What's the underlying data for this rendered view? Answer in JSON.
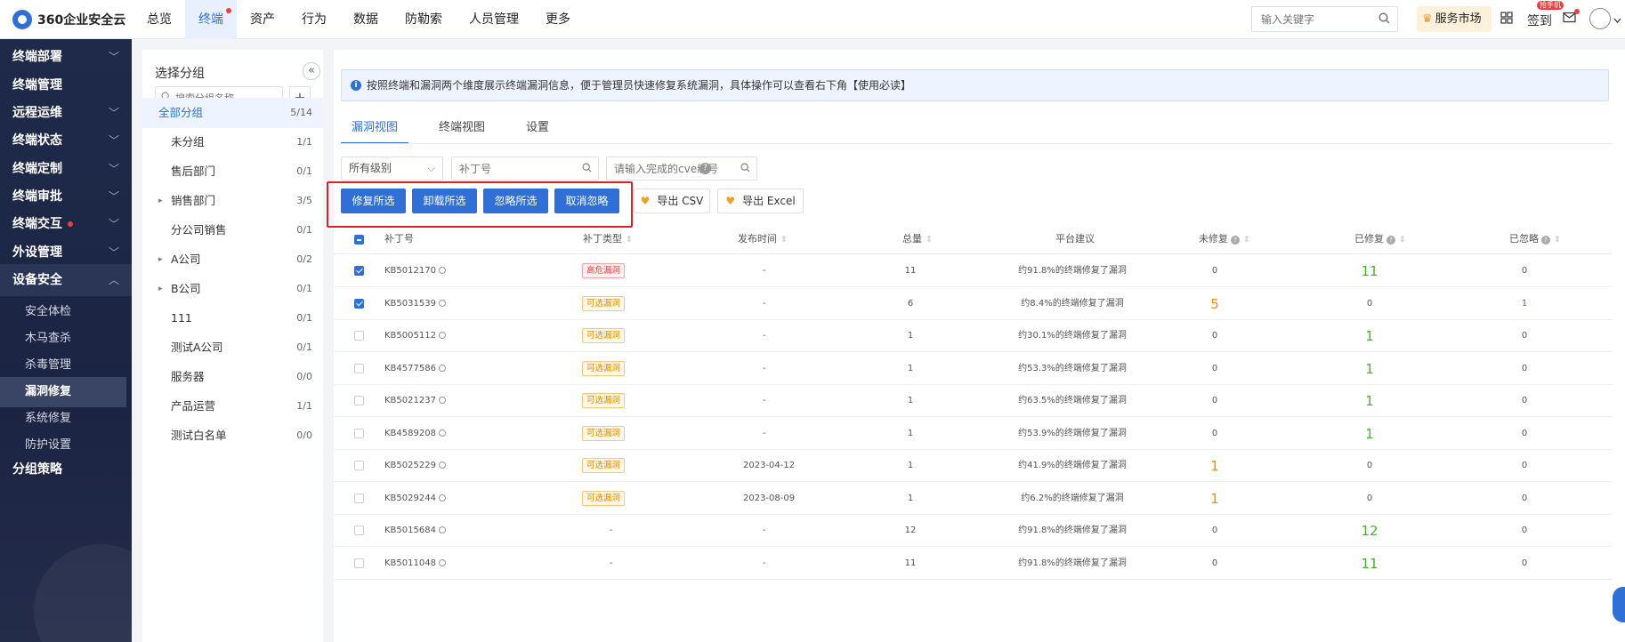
{
  "app": {
    "title": "360企业安全云"
  },
  "topnav": [
    {
      "label": "总览"
    },
    {
      "label": "终端",
      "active": true,
      "dot": true
    },
    {
      "label": "资产"
    },
    {
      "label": "行为"
    },
    {
      "label": "数据"
    },
    {
      "label": "防勒索"
    },
    {
      "label": "人员管理"
    },
    {
      "label": "更多"
    }
  ],
  "topbar": {
    "search_placeholder": "输入关键字",
    "service_market": "服务市场",
    "signin": "签到",
    "signin_badge": "抢手机"
  },
  "sidebar": {
    "items": [
      {
        "label": "终端部署",
        "chevron": "down"
      },
      {
        "label": "终端管理"
      },
      {
        "label": "远程运维",
        "chevron": "down"
      },
      {
        "label": "终端状态",
        "chevron": "down"
      },
      {
        "label": "终端定制",
        "chevron": "down"
      },
      {
        "label": "终端审批",
        "chevron": "down"
      },
      {
        "label": "终端交互",
        "chevron": "down",
        "dot": true
      },
      {
        "label": "外设管理",
        "chevron": "down"
      },
      {
        "label": "设备安全",
        "chevron": "up",
        "open": true
      },
      {
        "label": "分组策略"
      }
    ],
    "sub_items": [
      {
        "label": "安全体检"
      },
      {
        "label": "木马查杀"
      },
      {
        "label": "杀毒管理"
      },
      {
        "label": "漏洞修复",
        "active": true
      },
      {
        "label": "系统修复"
      },
      {
        "label": "防护设置"
      }
    ]
  },
  "group_panel": {
    "title": "选择分组",
    "search_placeholder": "搜索分组名称",
    "groups": [
      {
        "name": "全部分组",
        "count": "5/14",
        "root": true,
        "active": true
      },
      {
        "name": "未分组",
        "count": "1/1"
      },
      {
        "name": "售后部门",
        "count": "0/1"
      },
      {
        "name": "销售部门",
        "count": "3/5",
        "expandable": true
      },
      {
        "name": "分公司销售",
        "count": "0/1"
      },
      {
        "name": "A公司",
        "count": "0/2",
        "expandable": true
      },
      {
        "name": "B公司",
        "count": "0/1",
        "expandable": true
      },
      {
        "name": "111",
        "count": "0/1"
      },
      {
        "name": "测试A公司",
        "count": "0/1"
      },
      {
        "name": "服务器",
        "count": "0/0"
      },
      {
        "name": "产品运营",
        "count": "1/1"
      },
      {
        "name": "测试白名单",
        "count": "0/0"
      }
    ]
  },
  "notice": "按照终端和漏洞两个维度展示终端漏洞信息，便于管理员快速修复系统漏洞，具体操作可以查看右下角【使用必读】",
  "tabs": [
    {
      "label": "漏洞视图",
      "active": true
    },
    {
      "label": "终端视图"
    },
    {
      "label": "设置"
    }
  ],
  "filters": {
    "level": "所有级别",
    "patch_placeholder": "补丁号",
    "cve_placeholder": "请输入完成的cve编号"
  },
  "actions": {
    "fix": "修复所选",
    "uninstall": "卸载所选",
    "ignore": "忽略所选",
    "unignore": "取消忽略",
    "export_csv": "导出 CSV",
    "export_excel": "导出 Excel"
  },
  "table": {
    "headers": {
      "patch": "补丁号",
      "type": "补丁类型",
      "date": "发布时间",
      "total": "总量",
      "platform": "平台建议",
      "unfixed": "未修复",
      "fixed": "已修复",
      "ignored": "已忽略"
    },
    "rows": [
      {
        "checked": true,
        "patch": "KB5012170",
        "type": "高危漏洞",
        "type_kind": "high",
        "date": "-",
        "total": "11",
        "platform": "约91.8%的终端修复了漏洞",
        "unfixed": "0",
        "fixed": "11",
        "fixed_big": true,
        "ignored": "0"
      },
      {
        "checked": true,
        "patch": "KB5031539",
        "type": "可选漏洞",
        "type_kind": "opt",
        "date": "-",
        "total": "6",
        "platform": "约8.4%的终端修复了漏洞",
        "unfixed": "5",
        "unfixed_big": true,
        "fixed": "0",
        "ignored": "1",
        "ignored_link": true
      },
      {
        "checked": false,
        "patch": "KB5005112",
        "type": "可选漏洞",
        "type_kind": "opt",
        "date": "-",
        "total": "1",
        "platform": "约30.1%的终端修复了漏洞",
        "unfixed": "0",
        "fixed": "1",
        "fixed_big": true,
        "ignored": "0"
      },
      {
        "checked": false,
        "patch": "KB4577586",
        "type": "可选漏洞",
        "type_kind": "opt",
        "date": "-",
        "total": "1",
        "platform": "约53.3%的终端修复了漏洞",
        "unfixed": "0",
        "fixed": "1",
        "fixed_big": true,
        "ignored": "0"
      },
      {
        "checked": false,
        "patch": "KB5021237",
        "type": "可选漏洞",
        "type_kind": "opt",
        "date": "-",
        "total": "1",
        "platform": "约63.5%的终端修复了漏洞",
        "unfixed": "0",
        "fixed": "1",
        "fixed_big": true,
        "ignored": "0"
      },
      {
        "checked": false,
        "patch": "KB4589208",
        "type": "可选漏洞",
        "type_kind": "opt",
        "date": "-",
        "total": "1",
        "platform": "约53.9%的终端修复了漏洞",
        "unfixed": "0",
        "fixed": "1",
        "fixed_big": true,
        "ignored": "0"
      },
      {
        "checked": false,
        "patch": "KB5025229",
        "type": "可选漏洞",
        "type_kind": "opt",
        "date": "2023-04-12",
        "total": "1",
        "platform": "约41.9%的终端修复了漏洞",
        "unfixed": "1",
        "unfixed_big": true,
        "fixed": "0",
        "ignored": "0"
      },
      {
        "checked": false,
        "patch": "KB5029244",
        "type": "可选漏洞",
        "type_kind": "opt",
        "date": "2023-08-09",
        "total": "1",
        "platform": "约6.2%的终端修复了漏洞",
        "unfixed": "1",
        "unfixed_big": true,
        "fixed": "0",
        "ignored": "0"
      },
      {
        "checked": false,
        "patch": "KB5015684",
        "type": "-",
        "type_kind": "none",
        "date": "-",
        "total": "12",
        "platform": "约91.8%的终端修复了漏洞",
        "unfixed": "0",
        "fixed": "12",
        "fixed_big": true,
        "ignored": "0"
      },
      {
        "checked": false,
        "patch": "KB5011048",
        "type": "-",
        "type_kind": "none",
        "date": "-",
        "total": "11",
        "platform": "约91.8%的终端修复了漏洞",
        "unfixed": "0",
        "fixed": "11",
        "fixed_big": true,
        "ignored": "0"
      }
    ]
  },
  "colors": {
    "accent": "#2f6fd6",
    "sidebar_bg": "#1f2a4a",
    "danger": "#e02020",
    "fixed_green": "#4caf32",
    "unfixed_orange": "#f08c1a"
  }
}
